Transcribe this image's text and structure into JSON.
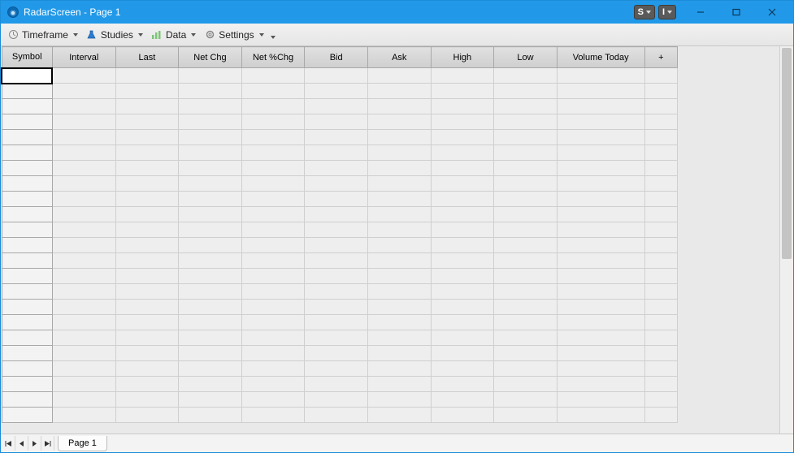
{
  "window": {
    "title": "RadarScreen - Page 1"
  },
  "toolbar": {
    "timeframe": "Timeframe",
    "studies": "Studies",
    "data": "Data",
    "settings": "Settings"
  },
  "titlebar_buttons": {
    "s": "S",
    "i": "I"
  },
  "columns": [
    "Symbol",
    "Interval",
    "Last",
    "Net Chg",
    "Net %Chg",
    "Bid",
    "Ask",
    "High",
    "Low",
    "Volume Today",
    "+"
  ],
  "rows": 23,
  "footer": {
    "page_tab": "Page 1"
  }
}
